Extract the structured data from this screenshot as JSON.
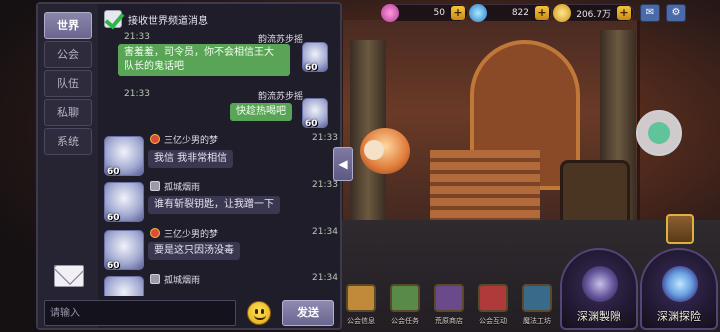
{
  "topbar": {
    "hearts_value": "50",
    "gems_value": "822",
    "coins_value": "206.7万",
    "plus_label": "+"
  },
  "chat": {
    "tabs": [
      {
        "label": "世界",
        "active": true
      },
      {
        "label": "公会",
        "active": false
      },
      {
        "label": "队伍",
        "active": false
      },
      {
        "label": "私聊",
        "active": false
      },
      {
        "label": "系统",
        "active": false
      }
    ],
    "channel_toggle_label": "接收世界频道消息",
    "channel_toggle_checked": true,
    "messages": [
      {
        "side": "self",
        "name": "韵流苏步摇",
        "time": "21:33",
        "text_line1": "害羞羞，司令员，你不会相信王大",
        "text_line2": "队长的鬼话吧",
        "level": "60"
      },
      {
        "side": "self",
        "name": "韵流苏步摇",
        "time": "21:33",
        "text_line1": "快趁热喝吧",
        "level": "60"
      },
      {
        "side": "other",
        "name": "三亿少男的梦",
        "time": "21:33",
        "text_line1": "我信 我非常相信",
        "level": "60"
      },
      {
        "side": "other",
        "name": "孤城烟雨",
        "time": "21:33",
        "text_line1": "谁有斩裂钥匙，让我蹭一下",
        "level": "60"
      },
      {
        "side": "other",
        "name": "三亿少男的梦",
        "time": "21:34",
        "text_line1": "要是这只因汤没毒",
        "level": "60"
      },
      {
        "side": "other",
        "name": "孤城烟雨",
        "time": "21:34",
        "text_line1": "",
        "level": ""
      }
    ],
    "input_placeholder": "请输入",
    "send_label": "发送",
    "collapse_arrow": "◀"
  },
  "right": {
    "deep_forge_label": "深渊製隙",
    "deep_explore_label": "深渊探险"
  },
  "dock": [
    {
      "label": "公会信息",
      "color": "#c08a3a"
    },
    {
      "label": "公会任务",
      "color": "#5a8a4a"
    },
    {
      "label": "荒原商店",
      "color": "#6a4a8a"
    },
    {
      "label": "公会互动",
      "color": "#b03a3a"
    },
    {
      "label": "魔法工坊",
      "color": "#3a6a8a"
    }
  ],
  "icons": {
    "mail": "mail-icon",
    "emoji": "smiley-icon",
    "top_icons": [
      "mail-icon",
      "gear-icon"
    ]
  }
}
